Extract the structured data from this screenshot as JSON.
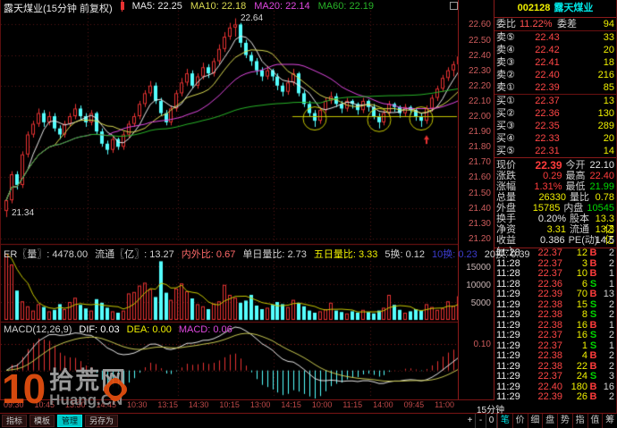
{
  "header": {
    "title": "露天煤业(15分钟 前复权)",
    "ma_items": [
      {
        "text": "MA5: 22.25",
        "color": "#e8e8e8"
      },
      {
        "text": "MA10: 22.18",
        "color": "#d8d850"
      },
      {
        "text": "MA20: 22.14",
        "color": "#e048e0"
      },
      {
        "text": "MA60: 22.19",
        "color": "#28b428"
      }
    ]
  },
  "chart_data": {
    "type": "candlestick",
    "period": "15分钟",
    "prev_close": 22.1,
    "peak_label": "22.64",
    "low_label": "21.34",
    "price_ticks": [
      "22.60",
      "22.50",
      "22.40",
      "22.30",
      "22.20",
      "22.10",
      "22.00",
      "21.90",
      "21.80",
      "21.70",
      "21.60",
      "21.50",
      "21.40",
      "21.30",
      "21.20"
    ],
    "ylim": [
      21.17,
      22.69
    ],
    "grid_step": 0.2,
    "day_separator_indices": [
      16,
      33,
      51,
      69
    ],
    "support_line": {
      "price": 22.0,
      "from_x": 326,
      "color": "#c8c800"
    },
    "circles": [
      {
        "index": 58,
        "price": 21.985
      },
      {
        "index": 70,
        "price": 21.975
      },
      {
        "index": 78,
        "price": 21.985
      }
    ],
    "arrow": {
      "index": 79,
      "price": 21.9
    },
    "candles": [
      [
        21.38,
        21.47,
        21.34,
        21.45
      ],
      [
        21.45,
        21.64,
        21.43,
        21.62
      ],
      [
        21.62,
        21.64,
        21.52,
        21.55
      ],
      [
        21.55,
        21.77,
        21.53,
        21.75
      ],
      [
        21.75,
        21.9,
        21.73,
        21.88
      ],
      [
        21.88,
        21.97,
        21.86,
        21.95
      ],
      [
        21.95,
        22.05,
        21.93,
        22.02
      ],
      [
        22.02,
        22.04,
        21.93,
        21.96
      ],
      [
        21.96,
        22.03,
        21.94,
        22.0
      ],
      [
        22.0,
        22.02,
        21.9,
        21.92
      ],
      [
        21.92,
        21.94,
        21.85,
        21.88
      ],
      [
        21.88,
        21.97,
        21.86,
        21.95
      ],
      [
        21.95,
        22.02,
        21.93,
        22.0
      ],
      [
        22.0,
        22.08,
        21.98,
        22.05
      ],
      [
        22.05,
        22.07,
        21.97,
        22.0
      ],
      [
        22.0,
        22.02,
        21.93,
        21.96
      ],
      [
        21.96,
        22.04,
        21.94,
        22.02
      ],
      [
        22.02,
        22.03,
        21.88,
        21.9
      ],
      [
        21.9,
        21.92,
        21.8,
        21.82
      ],
      [
        21.82,
        21.84,
        21.75,
        21.78
      ],
      [
        21.78,
        21.87,
        21.76,
        21.85
      ],
      [
        21.85,
        21.86,
        21.78,
        21.8
      ],
      [
        21.8,
        21.9,
        21.78,
        21.88
      ],
      [
        21.88,
        21.97,
        21.86,
        21.95
      ],
      [
        21.95,
        22.02,
        21.93,
        22.0
      ],
      [
        22.0,
        22.1,
        21.98,
        22.08
      ],
      [
        22.08,
        22.17,
        22.06,
        22.15
      ],
      [
        22.15,
        22.23,
        22.13,
        22.2
      ],
      [
        22.2,
        22.22,
        22.08,
        22.1
      ],
      [
        22.1,
        22.12,
        22.0,
        22.02
      ],
      [
        22.02,
        22.04,
        21.94,
        21.96
      ],
      [
        21.96,
        22.07,
        21.94,
        22.05
      ],
      [
        22.05,
        22.17,
        22.03,
        22.15
      ],
      [
        22.15,
        22.25,
        22.13,
        22.22
      ],
      [
        22.22,
        22.31,
        22.2,
        22.28
      ],
      [
        22.28,
        22.3,
        22.18,
        22.2
      ],
      [
        22.2,
        22.28,
        22.18,
        22.26
      ],
      [
        22.26,
        22.35,
        22.24,
        22.32
      ],
      [
        22.32,
        22.34,
        22.25,
        22.28
      ],
      [
        22.28,
        22.38,
        22.26,
        22.36
      ],
      [
        22.36,
        22.47,
        22.34,
        22.44
      ],
      [
        22.44,
        22.55,
        22.42,
        22.52
      ],
      [
        22.52,
        22.61,
        22.5,
        22.58
      ],
      [
        22.58,
        22.64,
        22.52,
        22.6
      ],
      [
        22.6,
        22.61,
        22.45,
        22.48
      ],
      [
        22.48,
        22.5,
        22.38,
        22.4
      ],
      [
        22.4,
        22.42,
        22.33,
        22.36
      ],
      [
        22.36,
        22.38,
        22.27,
        22.3
      ],
      [
        22.3,
        22.32,
        22.23,
        22.26
      ],
      [
        22.26,
        22.33,
        22.24,
        22.3
      ],
      [
        22.3,
        22.31,
        22.23,
        22.26
      ],
      [
        22.26,
        22.28,
        22.17,
        22.2
      ],
      [
        22.2,
        22.22,
        22.13,
        22.16
      ],
      [
        22.16,
        22.25,
        22.14,
        22.22
      ],
      [
        22.22,
        22.31,
        22.2,
        22.28
      ],
      [
        22.28,
        22.29,
        22.13,
        22.15
      ],
      [
        22.15,
        22.17,
        22.06,
        22.08
      ],
      [
        22.08,
        22.1,
        22.0,
        22.02
      ],
      [
        22.02,
        22.04,
        21.93,
        21.97
      ],
      [
        21.97,
        22.06,
        21.95,
        22.04
      ],
      [
        22.04,
        22.12,
        22.02,
        22.1
      ],
      [
        22.1,
        22.16,
        22.08,
        22.13
      ],
      [
        22.13,
        22.15,
        22.06,
        22.08
      ],
      [
        22.08,
        22.1,
        22.02,
        22.05
      ],
      [
        22.05,
        22.12,
        22.03,
        22.1
      ],
      [
        22.1,
        22.11,
        22.05,
        22.08
      ],
      [
        22.08,
        22.09,
        22.01,
        22.04
      ],
      [
        22.04,
        22.12,
        22.02,
        22.1
      ],
      [
        22.1,
        22.11,
        22.03,
        22.06
      ],
      [
        22.06,
        22.08,
        21.98,
        22.0
      ],
      [
        22.0,
        22.02,
        21.92,
        21.96
      ],
      [
        21.96,
        22.04,
        21.94,
        22.02
      ],
      [
        22.02,
        22.1,
        22.0,
        22.08
      ],
      [
        22.08,
        22.09,
        22.03,
        22.06
      ],
      [
        22.06,
        22.07,
        21.99,
        22.02
      ],
      [
        22.02,
        22.08,
        22.0,
        22.06
      ],
      [
        22.06,
        22.07,
        22.01,
        22.04
      ],
      [
        22.04,
        22.05,
        21.97,
        22.0
      ],
      [
        22.0,
        22.02,
        21.93,
        21.97
      ],
      [
        21.97,
        22.07,
        21.95,
        22.05
      ],
      [
        22.05,
        22.14,
        22.03,
        22.12
      ],
      [
        22.12,
        22.2,
        22.1,
        22.18
      ],
      [
        22.18,
        22.27,
        22.16,
        22.25
      ],
      [
        22.25,
        22.32,
        22.23,
        22.3
      ],
      [
        22.3,
        22.36,
        22.26,
        22.34
      ],
      [
        22.34,
        22.46,
        22.32,
        22.39
      ]
    ],
    "ma_windows": [
      5,
      10,
      20,
      60
    ],
    "ma_colors": [
      "#e8e8e8",
      "#d8d850",
      "#e048e0",
      "#28b428"
    ],
    "volume": {
      "yticks": [
        "15000",
        "10000",
        "5000"
      ],
      "values": [
        18800,
        15500,
        8200,
        5200,
        3800,
        2600,
        4400,
        3600,
        2400,
        2800,
        4400,
        3000,
        5000,
        6200,
        4200,
        3200,
        2600,
        5800,
        4800,
        3400,
        2400,
        2000,
        2600,
        7400,
        7800,
        9600,
        10400,
        8600,
        6400,
        16400,
        7600,
        5600,
        8800,
        10200,
        8000,
        6000,
        4400,
        3800,
        3000,
        4600,
        5200,
        9800,
        7000,
        6200,
        4800,
        5400,
        7000,
        4000,
        3000,
        3400,
        4200,
        5000,
        4400,
        3600,
        5600,
        4800,
        3800,
        2600,
        2000,
        2400,
        3000,
        4800,
        2600,
        2200,
        1800,
        2400,
        2000,
        2800,
        2200,
        1800,
        2600,
        3400,
        7000,
        4200,
        2800,
        2000,
        2400,
        3000,
        2600,
        4400,
        3600,
        2800,
        3200,
        5200,
        4000,
        6600
      ]
    },
    "macd_axis_label": "0.10",
    "time_labels": [
      "09:30",
      "10:45",
      "13:30",
      "14:45",
      "10:30",
      "13:15",
      "14:30",
      "10:15",
      "13:00",
      "14:15",
      "10:00",
      "11:15",
      "14:00",
      "09:45",
      "11:00"
    ]
  },
  "vol_header": [
    {
      "text": "ER〖量〗: 4478.00",
      "color": "#d0d0d0"
    },
    {
      "text": "流通〖亿〗: 13.27",
      "color": "#d0d0d0"
    },
    {
      "text": "内外比: 0.67",
      "color": "#ff6a6a"
    },
    {
      "text": "单日量比: 2.73",
      "color": "#d0d0d0"
    },
    {
      "text": "五日量比: 3.33",
      "color": "#f0f000"
    },
    {
      "text": "5换: 0.12",
      "color": "#d0d0d0"
    },
    {
      "text": "10换: 0.23",
      "color": "#3c3ccd"
    },
    {
      "text": "20换: 0.39",
      "color": "#d0d0d0"
    }
  ],
  "macd_header": [
    {
      "text": "MACD(12,26,9)",
      "color": "#d0d0d0"
    },
    {
      "text": "DIF: 0.03",
      "color": "#ffffff"
    },
    {
      "text": "DEA: 0.00",
      "color": "#f0f000"
    },
    {
      "text": "MACD: 0.06",
      "color": "#e048e0"
    }
  ],
  "quote_panel": {
    "code": "002128",
    "name": "露天煤业",
    "weibi_label": "委比",
    "weibi_value": "11.22%",
    "weicha_label": "委差",
    "weicha_value": "94",
    "asks": [
      {
        "label": "卖⑤",
        "price": "22.43",
        "vol": "33"
      },
      {
        "label": "卖④",
        "price": "22.42",
        "vol": "20"
      },
      {
        "label": "卖③",
        "price": "22.41",
        "vol": "18"
      },
      {
        "label": "卖②",
        "price": "22.40",
        "vol": "216"
      },
      {
        "label": "卖①",
        "price": "22.39",
        "vol": "85"
      }
    ],
    "bids": [
      {
        "label": "买①",
        "price": "22.37",
        "vol": "13"
      },
      {
        "label": "买②",
        "price": "22.36",
        "vol": "130"
      },
      {
        "label": "买③",
        "price": "22.35",
        "vol": "289"
      },
      {
        "label": "买④",
        "price": "22.33",
        "vol": "20"
      },
      {
        "label": "买⑤",
        "price": "22.31",
        "vol": "14"
      }
    ],
    "info_rows": [
      {
        "l1": "现价",
        "v1": "22.39",
        "c1": "#ff3c3c",
        "b1": true,
        "l2": "今开",
        "v2": "22.10",
        "c2": "#e8e8e8"
      },
      {
        "l1": "涨跌",
        "v1": "0.29",
        "c1": "#ff3c3c",
        "b1": false,
        "l2": "最高",
        "v2": "22.40",
        "c2": "#ff3c3c"
      },
      {
        "l1": "涨幅",
        "v1": "1.31%",
        "c1": "#ff3c3c",
        "b1": false,
        "l2": "最低",
        "v2": "21.99",
        "c2": "#00d800"
      },
      {
        "l1": "总量",
        "v1": "26330",
        "c1": "#f0f000",
        "b1": false,
        "l2": "量比",
        "v2": "0.78",
        "c2": "#f0f000"
      },
      {
        "l1": "外盘",
        "v1": "15785",
        "c1": "#f0f000",
        "b1": false,
        "l2": "内盘",
        "v2": "10545",
        "c2": "#00d800"
      },
      {
        "l1": "换手",
        "v1": "0.20%",
        "c1": "#e8e8e8",
        "b1": false,
        "l2": "股本",
        "v2": "13.3亿",
        "c2": "#f0f000"
      },
      {
        "l1": "净资",
        "v1": "3.31",
        "c1": "#f0f000",
        "b1": false,
        "l2": "流通",
        "v2": "13.3亿",
        "c2": "#f0f000"
      },
      {
        "l1": "收益(一)",
        "v1": "0.386",
        "c1": "#e8e8e8",
        "b1": false,
        "l2": "PE(动)",
        "v2": "14.5",
        "c2": "#e8e8e8"
      }
    ],
    "ticks": [
      {
        "time": "11:28",
        "price": "22.37",
        "vol": "12",
        "bs": "B",
        "count": "2"
      },
      {
        "time": "11:28",
        "price": "22.37",
        "vol": "3",
        "bs": "B",
        "count": "2"
      },
      {
        "time": "11:28",
        "price": "22.37",
        "vol": "10",
        "bs": "B",
        "count": "1"
      },
      {
        "time": "11:28",
        "price": "22.36",
        "vol": "6",
        "bs": "S",
        "count": "1"
      },
      {
        "time": "11:29",
        "price": "22.39",
        "vol": "70",
        "bs": "B",
        "count": "13"
      },
      {
        "time": "11:29",
        "price": "22.38",
        "vol": "15",
        "bs": "S",
        "count": "2"
      },
      {
        "time": "11:29",
        "price": "22.38",
        "vol": "8",
        "bs": "S",
        "count": "2"
      },
      {
        "time": "11:29",
        "price": "22.38",
        "vol": "16",
        "bs": "B",
        "count": "1"
      },
      {
        "time": "11:29",
        "price": "22.37",
        "vol": "16",
        "bs": "S",
        "count": "2"
      },
      {
        "time": "11:29",
        "price": "22.37",
        "vol": "1",
        "bs": "S",
        "count": "1"
      },
      {
        "time": "11:29",
        "price": "22.38",
        "vol": "4",
        "bs": "B",
        "count": "2"
      },
      {
        "time": "11:29",
        "price": "22.38",
        "vol": "22",
        "bs": "B",
        "count": "2"
      },
      {
        "time": "11:29",
        "price": "22.37",
        "vol": "24",
        "bs": "S",
        "count": "3"
      },
      {
        "time": "11:29",
        "price": "22.40",
        "vol": "180",
        "bs": "B",
        "count": "16"
      },
      {
        "time": "11:29",
        "price": "22.39",
        "vol": "26",
        "bs": "B",
        "count": "2"
      }
    ]
  },
  "bottom": {
    "period_label": "15分钟",
    "zoom_controls": [
      "+",
      "-",
      "0"
    ],
    "tabs": [
      {
        "label": "笔",
        "active": true
      },
      {
        "label": "价",
        "active": false
      },
      {
        "label": "细",
        "active": false
      },
      {
        "label": "盘",
        "active": false
      },
      {
        "label": "势",
        "active": false
      },
      {
        "label": "指",
        "active": false
      },
      {
        "label": "值",
        "active": false
      },
      {
        "label": "筹",
        "active": false
      }
    ],
    "menu_items": [
      {
        "label": "指标",
        "active": false
      },
      {
        "label": "模板",
        "active": false
      },
      {
        "label": "管理",
        "active": true
      },
      {
        "label": "另存为",
        "active": false
      }
    ]
  },
  "watermark": {
    "ten": "10",
    "site": "拾荒网",
    "domain": "Huang.CN"
  },
  "colors": {
    "up": "#e83232",
    "down": "#54ffff",
    "grid": "#5a1616",
    "axis_text": "#cd5c5c",
    "yellow": "#f0f000",
    "green": "#00d800",
    "red": "#ff3c3c"
  }
}
